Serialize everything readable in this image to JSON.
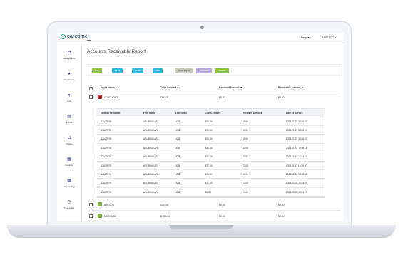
{
  "topbar": {
    "logo": "caretime",
    "help": "Help ▾",
    "user": "JAXFOXI ▾"
  },
  "sidebar": {
    "items": [
      {
        "label": "Manage Lists",
        "icon": "list-icon"
      },
      {
        "label": "Employees",
        "icon": "employees-icon"
      },
      {
        "label": "Jobs",
        "icon": "jobs-icon"
      },
      {
        "label": "Forms",
        "icon": "forms-icon"
      },
      {
        "label": "Claims",
        "icon": "claims-icon"
      },
      {
        "label": "Invoicing",
        "icon": "invoicing-icon"
      },
      {
        "label": "Scheduling",
        "icon": "calendar-icon"
      },
      {
        "label": "Time Card",
        "icon": "clock-icon"
      }
    ]
  },
  "page": {
    "title": "Accounts Receivable Report"
  },
  "filters": {
    "buttons": [
      {
        "label": "0-30",
        "color": "#8cbf3f"
      },
      {
        "label": "31-60",
        "color": "#35b8d8"
      },
      {
        "label": "61-90",
        "color": "#35b8d8"
      },
      {
        "label": "+90",
        "color": "#35b8d8"
      },
      {
        "label": "Excel Export",
        "color": "#c8cbbb"
      },
      {
        "label": "Pdf Export",
        "color": "#b6a9d6"
      },
      {
        "label": "Search",
        "color": "#8cbf3f"
      }
    ]
  },
  "table": {
    "headers": [
      "Payer Name ▲",
      "Claim Amount ▼",
      "Received Amount ▼",
      "Receivable Amount ▼"
    ],
    "rows": [
      {
        "payer": "ADVCHOICE",
        "claim": "$300.00",
        "received": "$0.00",
        "receivable": "$0.00"
      },
      {
        "payer": "AZECOS",
        "claim": "$347.00",
        "received": "$0.00",
        "receivable": "$0.00"
      },
      {
        "payer": "MEDICAID",
        "claim": "$1,000.00",
        "received": "$0.00",
        "receivable": "$0.00"
      }
    ]
  },
  "subtable": {
    "headers": [
      "Medical Record Id",
      "First Name",
      "Last Name",
      "Claim Amount",
      "Received Amount",
      "Date Of Service"
    ],
    "rows": [
      [
        "A3A29978",
        "ARUBHAKAR",
        "JOB",
        "$30.00",
        "$0.00",
        "2023-01-31 00:00:00"
      ],
      [
        "A3A29978",
        "ARUBHAKAR",
        "JOB",
        "$30.00",
        "$0.00",
        "2023-01-31 00:00:00"
      ],
      [
        "A3A29978",
        "ARUBHAKAR",
        "JOB",
        "$30.00",
        "$0.00",
        "2023-01-31 00:00:00"
      ],
      [
        "A3A29978",
        "ARUBHAKAR",
        "JOB",
        "$80.00",
        "$0.00",
        "2023-01-31 16:06:18"
      ],
      [
        "A3A29978",
        "ARUBHAKAR",
        "JOB",
        "$30.00",
        "$0.00",
        "2023-10-19 12:44:00"
      ],
      [
        "A3A29978",
        "ARUBHAKAR",
        "JOB",
        "$30.00",
        "$0.00",
        "2023-11-13 16:26:00"
      ],
      [
        "A3A29978",
        "ARUBHAKAR",
        "JOB",
        "$30.00",
        "$0.00",
        "2023-02-03 15:35:46"
      ],
      [
        "A3A29978",
        "ARUBHAKAR",
        "JOB",
        "$30.00",
        "$0.00",
        "2023-02-03 15:15:09"
      ],
      [
        "A3A29978",
        "ARUBHAKAR",
        "JOB",
        "$4.00",
        "$0.00",
        "2023-02-03 15:15:09"
      ]
    ]
  }
}
